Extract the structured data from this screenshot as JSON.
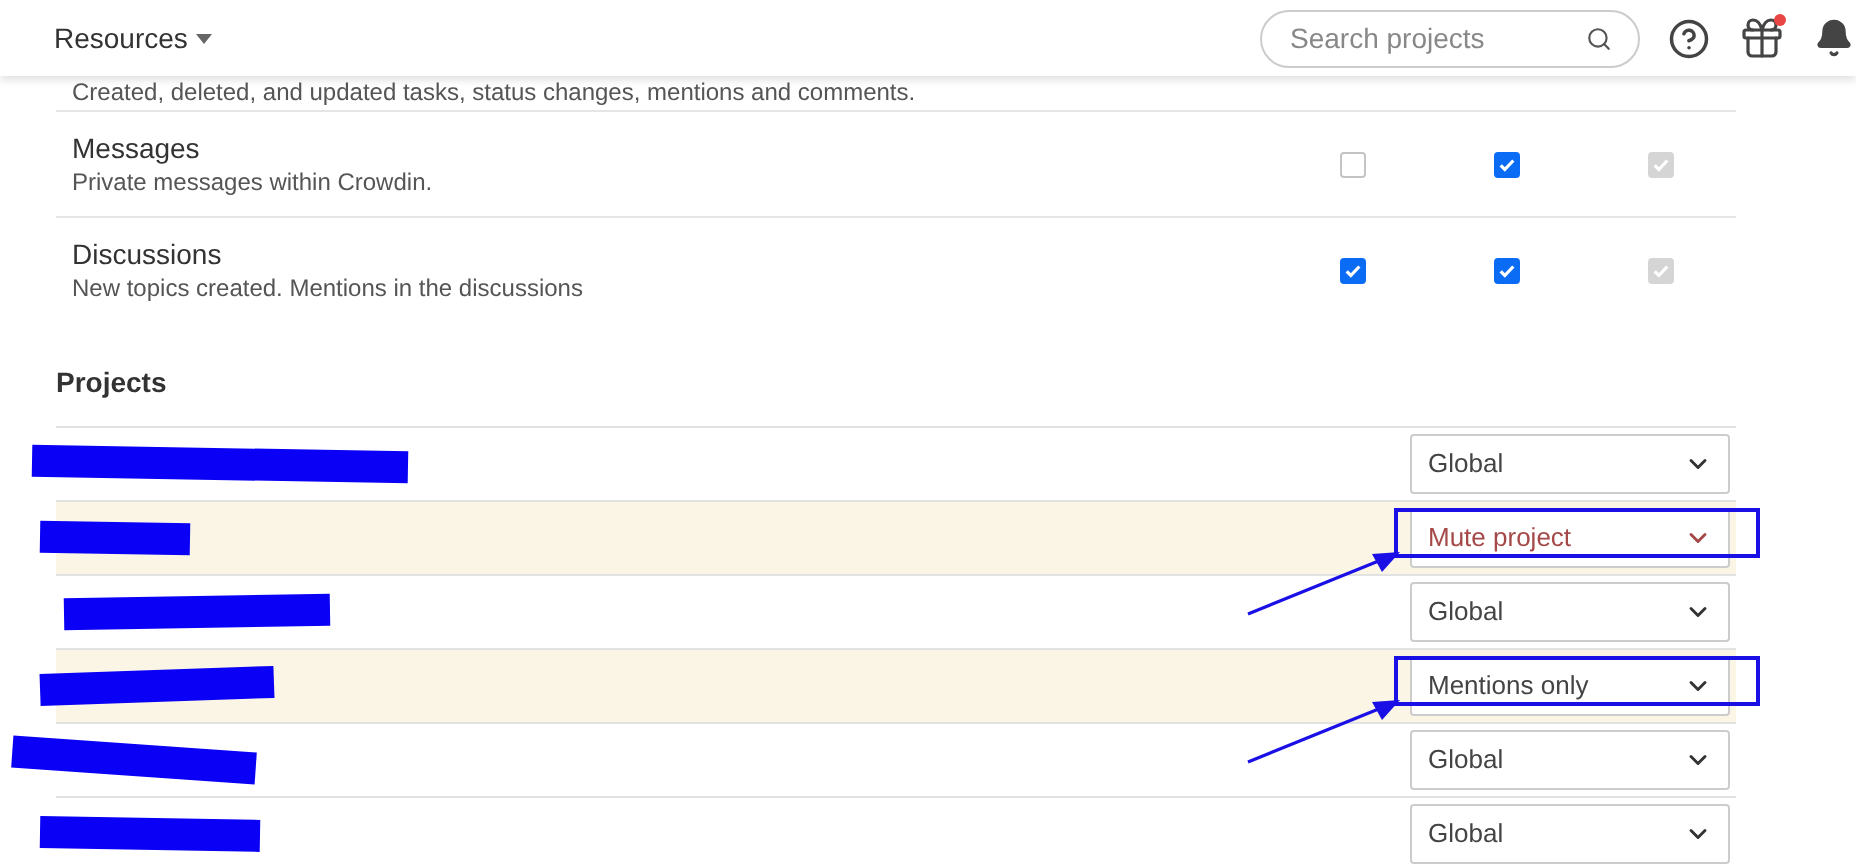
{
  "header": {
    "menu": "Resources",
    "search": {
      "placeholder": "Search projects"
    },
    "gift_badge": true
  },
  "notifications": [
    {
      "description": "Created, deleted, and updated tasks, status changes, mentions and comments."
    },
    {
      "title": "Messages",
      "description": "Private messages within Crowdin.",
      "checks": [
        {
          "checked": false,
          "disabled": false
        },
        {
          "checked": true,
          "disabled": false
        },
        {
          "checked": true,
          "disabled": true
        }
      ]
    },
    {
      "title": "Discussions",
      "description": "New topics created. Mentions in the discussions",
      "checks": [
        {
          "checked": true,
          "disabled": false
        },
        {
          "checked": true,
          "disabled": false
        },
        {
          "checked": true,
          "disabled": true
        }
      ]
    }
  ],
  "projects": {
    "heading": "Projects",
    "rows": [
      {
        "setting": "Global",
        "highlighted": false,
        "annotated": false,
        "kind": "normal"
      },
      {
        "setting": "Mute project",
        "highlighted": true,
        "annotated": true,
        "kind": "muted"
      },
      {
        "setting": "Global",
        "highlighted": false,
        "annotated": false,
        "kind": "normal"
      },
      {
        "setting": "Mentions only",
        "highlighted": true,
        "annotated": true,
        "kind": "normal"
      },
      {
        "setting": "Global",
        "highlighted": false,
        "annotated": false,
        "kind": "normal"
      },
      {
        "setting": "Global",
        "highlighted": false,
        "annotated": false,
        "kind": "normal"
      }
    ]
  }
}
